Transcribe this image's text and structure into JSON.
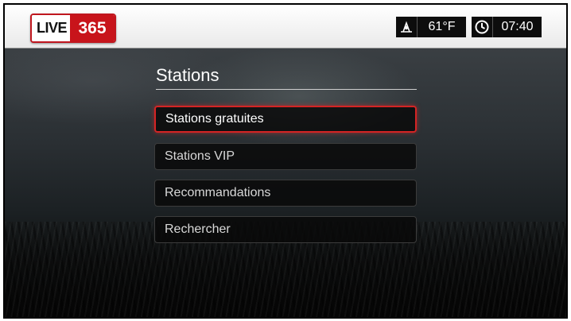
{
  "brand": {
    "live": "LIVE",
    "number": "365"
  },
  "status": {
    "weather_icon": "weather-icon",
    "temperature": "61°F",
    "clock_icon": "clock-icon",
    "time": "07:40"
  },
  "menu": {
    "title": "Stations",
    "items": [
      {
        "label": "Stations gratuites",
        "selected": true
      },
      {
        "label": "Stations VIP"
      },
      {
        "label": "Recommandations"
      },
      {
        "label": "Rechercher"
      }
    ]
  },
  "colors": {
    "accent": "#d42424",
    "brand_red": "#c8141b"
  }
}
